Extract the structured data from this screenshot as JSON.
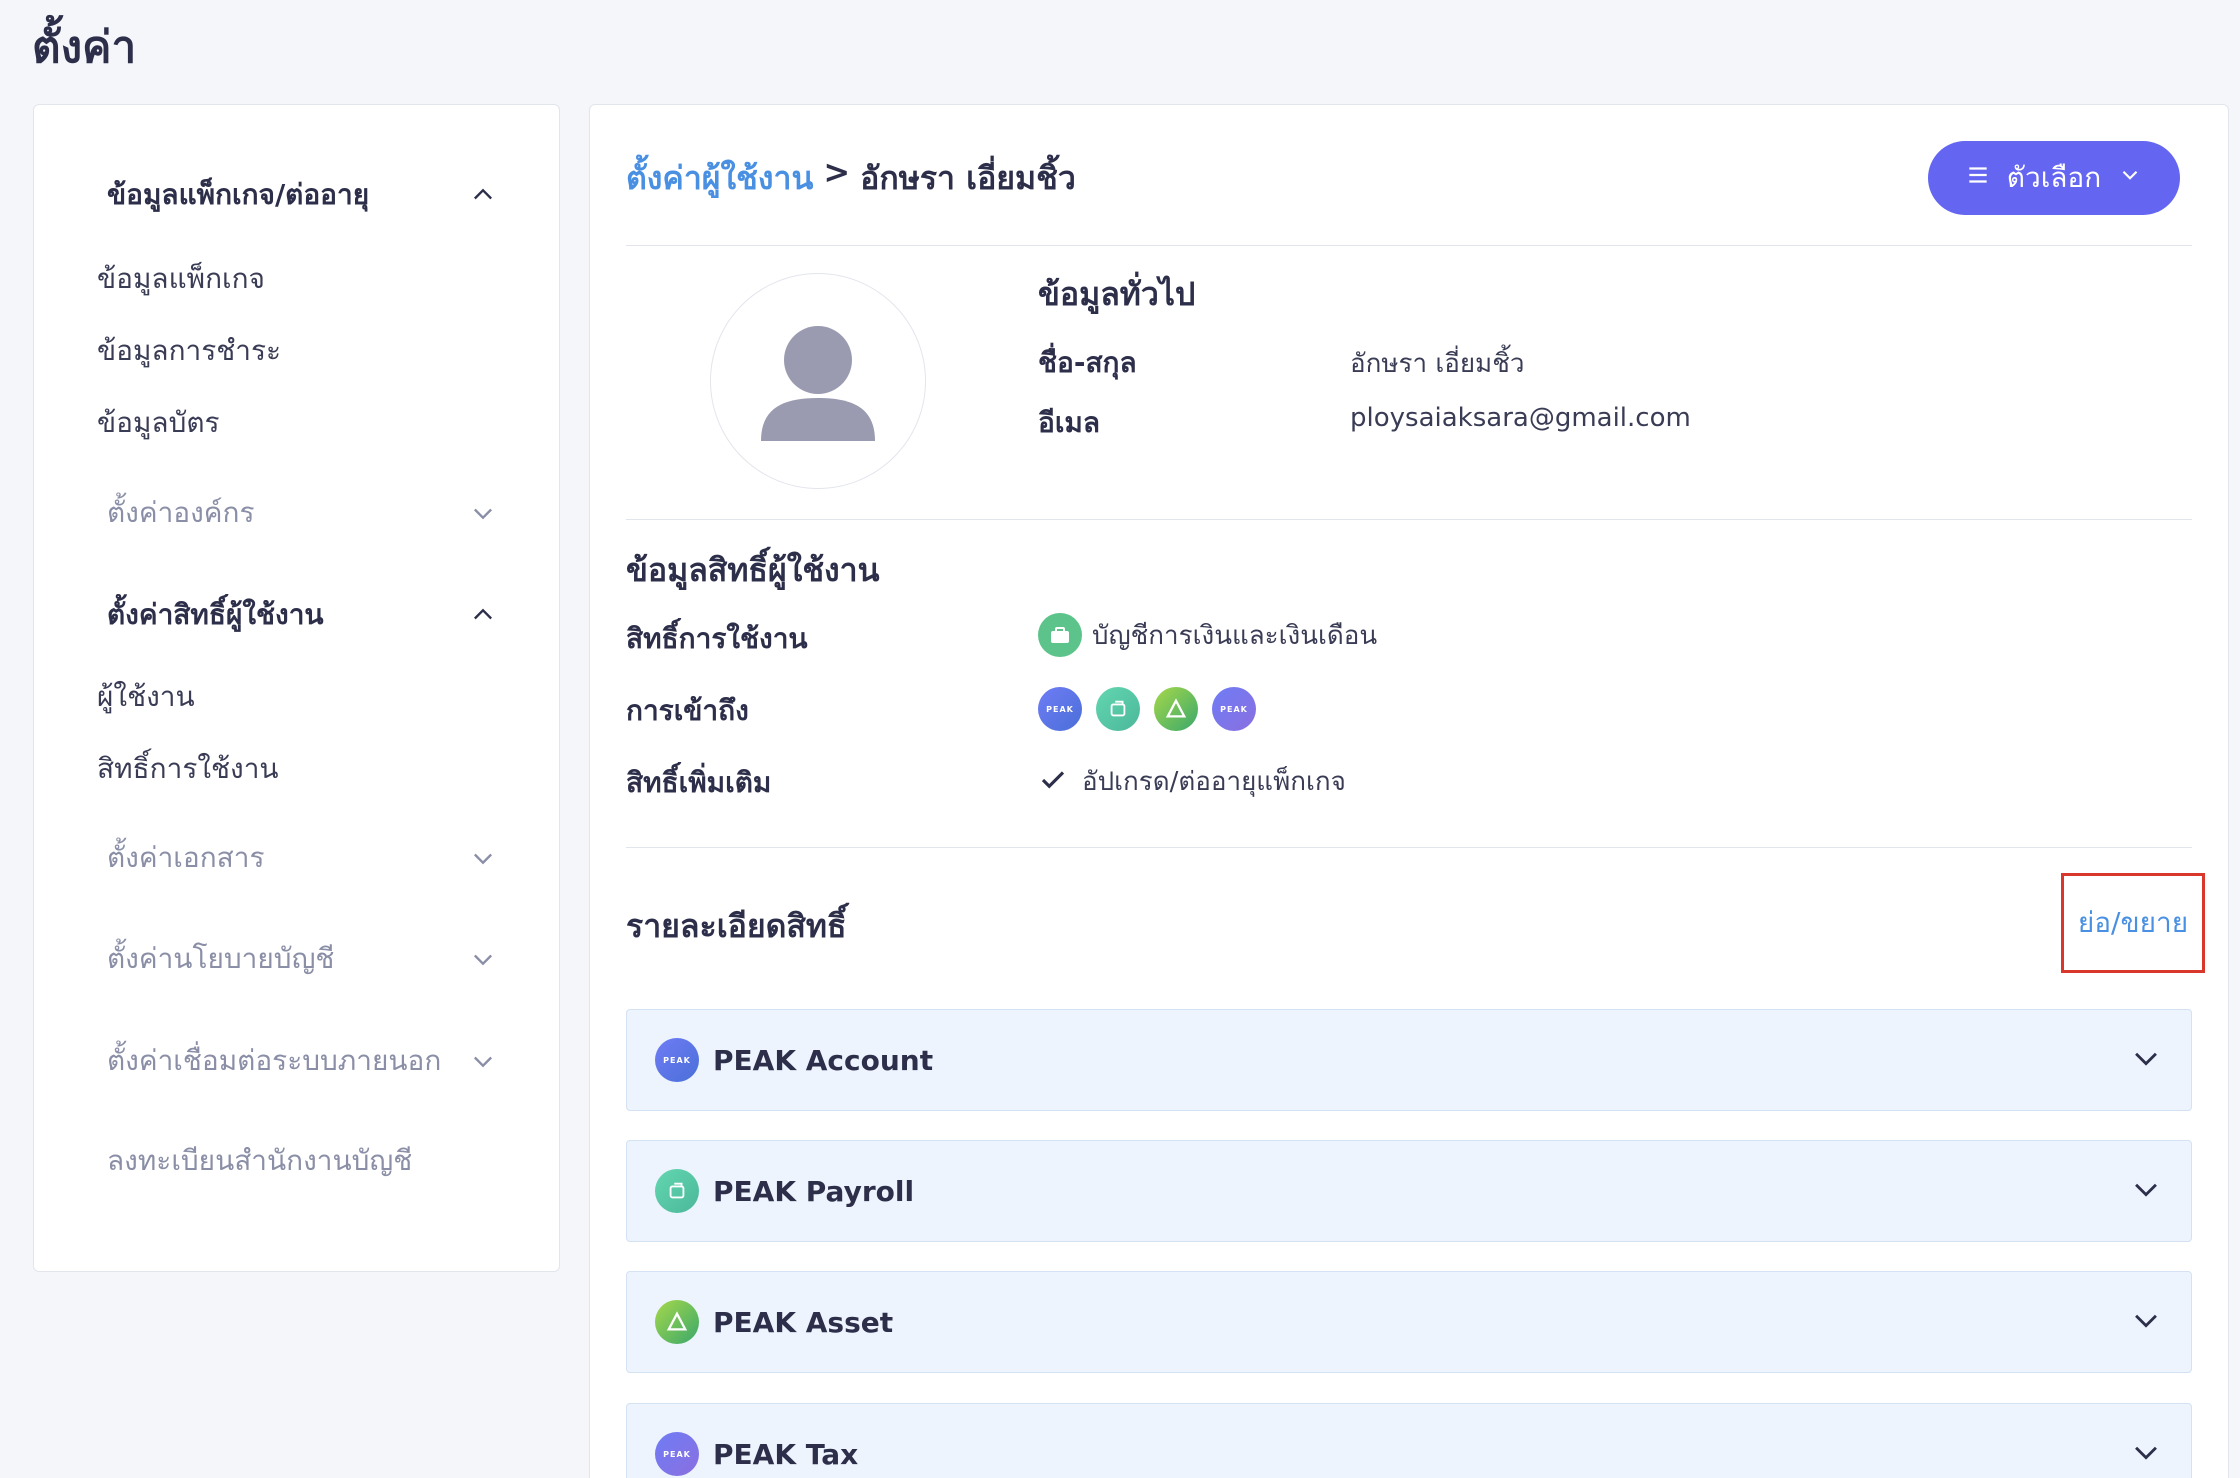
{
  "page": {
    "title": "ตั้งค่า"
  },
  "sidebar": {
    "groups": [
      {
        "label": "ข้อมูลแพ็กเกจ/ต่ออายุ",
        "expanded": true,
        "items": [
          "ข้อมูลแพ็กเกจ",
          "ข้อมูลการชำระ",
          "ข้อมูลบัตร"
        ]
      },
      {
        "label": "ตั้งค่าองค์กร",
        "expanded": false,
        "items": []
      },
      {
        "label": "ตั้งค่าสิทธิ์ผู้ใช้งาน",
        "expanded": true,
        "items": [
          "ผู้ใช้งาน",
          "สิทธิ์การใช้งาน"
        ]
      },
      {
        "label": "ตั้งค่าเอกสาร",
        "expanded": false,
        "items": []
      },
      {
        "label": "ตั้งค่านโยบายบัญชี",
        "expanded": false,
        "items": []
      },
      {
        "label": "ตั้งค่าเชื่อมต่อระบบภายนอก",
        "expanded": false,
        "items": []
      },
      {
        "label": "ลงทะเบียนสำนักงานบัญชี",
        "expanded": false,
        "items": []
      }
    ]
  },
  "breadcrumb": {
    "link": "ตั้งค่าผู้ใช้งาน",
    "separator": ">",
    "current": "อักษรา เอี่ยมชิ้ว"
  },
  "options_button": {
    "label": "ตัวเลือก",
    "icon": "menu-icon"
  },
  "general_info": {
    "title": "ข้อมูลทั่วไป",
    "fields": [
      {
        "label": "ชื่อ-สกุล",
        "value": "อักษรา เอี่ยมชิ้ว"
      },
      {
        "label": "อีเมล",
        "value": "ploysaiaksara@gmail.com"
      }
    ]
  },
  "permission_info": {
    "title": "ข้อมูลสิทธิ์ผู้ใช้งาน",
    "role_label": "สิทธิ์การใช้งาน",
    "role_value": "บัญชีการเงินและเงินเดือน",
    "access_label": "การเข้าถึง",
    "access_apps": [
      {
        "icon": "peak-account-icon",
        "text": "PEAK"
      },
      {
        "icon": "peak-payroll-icon",
        "text": ""
      },
      {
        "icon": "peak-asset-icon",
        "text": ""
      },
      {
        "icon": "peak-tax-icon",
        "text": "PEAK"
      }
    ],
    "extra_label": "สิทธิ์เพิ่มเติม",
    "extra_value": "อัปเกรด/ต่ออายุแพ็กเกจ"
  },
  "permission_details": {
    "title": "รายละเอียดสิทธิ์",
    "toggle_label": "ย่อ/ขยาย",
    "apps": [
      {
        "name": "PEAK Account",
        "icon": "peak-account-icon"
      },
      {
        "name": "PEAK Payroll",
        "icon": "peak-payroll-icon"
      },
      {
        "name": "PEAK Asset",
        "icon": "peak-asset-icon"
      },
      {
        "name": "PEAK Tax",
        "icon": "peak-tax-icon"
      }
    ]
  },
  "colors": {
    "primary": "#6466f1",
    "link": "#4a90e2",
    "highlight": "#d9372b",
    "accordion_bg": "#edf4fd"
  }
}
